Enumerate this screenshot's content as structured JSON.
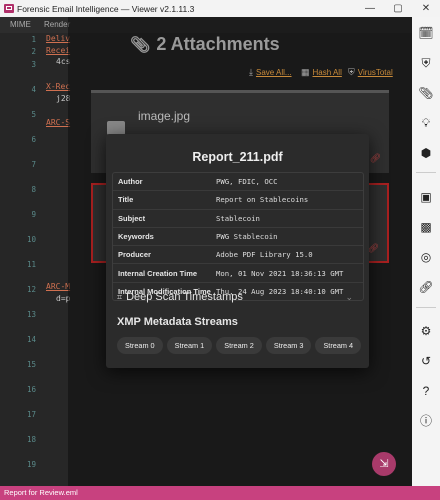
{
  "window": {
    "title": "Forensic Email Intelligence — Viewer v2.1.11.3",
    "minimize": "—",
    "maximize": "▢",
    "close": "✕"
  },
  "editor": {
    "tabs": [
      "MIME",
      "Render"
    ],
    "line_numbers": [
      "1",
      "2",
      "3",
      "4",
      "5",
      "6",
      "7",
      "8",
      "9",
      "10",
      "11",
      "12",
      "13",
      "14",
      "15",
      "16",
      "17",
      "18",
      "19"
    ],
    "lines": [
      {
        "text": "Deliv",
        "style": "link"
      },
      {
        "text": "Recei",
        "style": "link"
      },
      {
        "text": "4cs",
        "style": "val"
      },
      {
        "text": "X-Rec",
        "style": "link"
      },
      {
        "text": "j28",
        "style": "val"
      },
      {
        "text": "ARC-S",
        "style": "link"
      },
      {
        "text": "ARC-M",
        "style": "link"
      },
      {
        "text": "d=p",
        "style": "val"
      }
    ]
  },
  "attachments": {
    "title": "2 Attachments",
    "save_all": "Save All...",
    "hash_all": "Hash All",
    "virustotal": "VirusTotal",
    "card1_name": "image.jpg"
  },
  "popover": {
    "filename": "Report_211.pdf",
    "metadata": [
      {
        "key": "Author",
        "value": "PWG, FDIC, OCC"
      },
      {
        "key": "Title",
        "value": "Report on Stablecoins"
      },
      {
        "key": "Subject",
        "value": "Stablecoin"
      },
      {
        "key": "Keywords",
        "value": "PWG Stablecoin"
      },
      {
        "key": "Producer",
        "value": "Adobe PDF Library 15.0"
      },
      {
        "key": "Internal Creation Time",
        "value": "Mon, 01 Nov 2021 18:36:13 GMT"
      },
      {
        "key": "Internal Modification Time",
        "value": "Thu, 24 Aug 2023 18:40:10 GMT"
      }
    ],
    "deep_scan": "Deep Scan Timestamps",
    "xmp_title": "XMP Metadata Streams",
    "streams": [
      "Stream 0",
      "Stream 1",
      "Stream 2",
      "Stream 3",
      "Stream 4"
    ]
  },
  "statusbar": {
    "file": "Report for Review.eml"
  },
  "colors": {
    "accent": "#c8417f",
    "danger": "#a82020"
  }
}
